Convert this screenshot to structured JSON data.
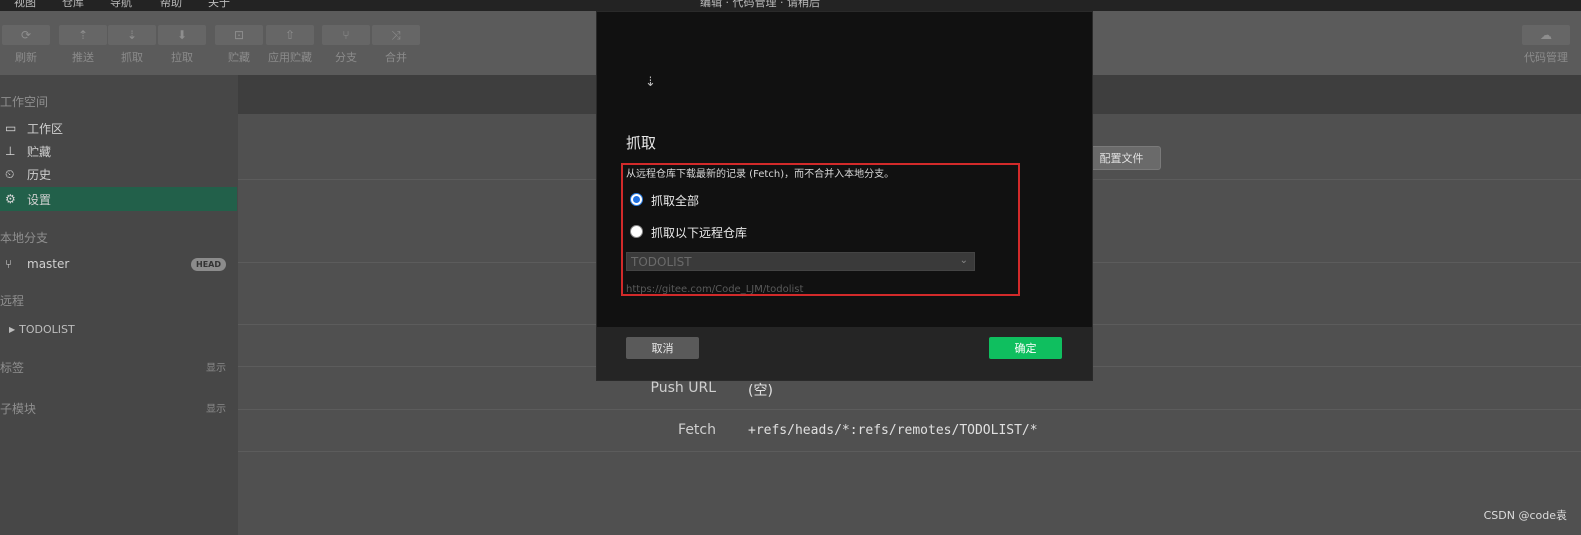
{
  "menu": [
    "视图",
    "仓库",
    "导航",
    "帮助",
    "关于"
  ],
  "title": "编辑 · 代码管理 · 请稍后",
  "toolbar": {
    "buttons": [
      {
        "label": "刷新",
        "icon": "refresh-icon",
        "glyph": "⟳"
      },
      {
        "label": "推送",
        "icon": "push-icon",
        "glyph": "⇡"
      },
      {
        "label": "抓取",
        "icon": "fetch-icon",
        "glyph": "⇣"
      },
      {
        "label": "拉取",
        "icon": "pull-icon",
        "glyph": "⬇"
      },
      {
        "label": "贮藏",
        "icon": "stash-icon",
        "glyph": "⊡"
      },
      {
        "label": "应用贮藏",
        "icon": "apply-stash-icon",
        "glyph": "⇧"
      },
      {
        "label": "分支",
        "icon": "branch-icon",
        "glyph": "⑂"
      },
      {
        "label": "合并",
        "icon": "merge-icon",
        "glyph": "⤨"
      }
    ],
    "right_button": {
      "label": "代码管理",
      "icon": "cloud-icon",
      "glyph": "☁"
    }
  },
  "sidebar": {
    "workspace_header": "工作空间",
    "items": [
      {
        "label": "工作区",
        "icon": "folder-icon",
        "glyph": "▭"
      },
      {
        "label": "贮藏",
        "icon": "stash-icon",
        "glyph": "⊥"
      },
      {
        "label": "历史",
        "icon": "history-icon",
        "glyph": "⏲"
      },
      {
        "label": "设置",
        "icon": "gear-icon",
        "glyph": "⚙"
      }
    ],
    "local_branches_header": "本地分支",
    "branch": {
      "name": "master",
      "badge": "HEAD"
    },
    "remote_header": "远程",
    "remote": {
      "name": "TODOLIST"
    },
    "tags_header": "标签",
    "tags_show": "显示",
    "submodules_header": "子模块",
    "submodules_show": "显示"
  },
  "main": {
    "config_button": "配置文件",
    "push_url_label": "Push URL",
    "push_url_value": "(空)",
    "fetch_label": "Fetch",
    "fetch_value": "+refs/heads/*:refs/remotes/TODOLIST/*"
  },
  "dialog": {
    "title": "抓取",
    "description": "从远程仓库下载最新的记录 (Fetch)，而不合并入本地分支。",
    "option_all": "抓取全部",
    "option_remote": "抓取以下远程仓库",
    "selected_option": "all",
    "remote_select_value": "TODOLIST",
    "remote_url": "https://gitee.com/Code_LJM/todolist",
    "cancel_label": "取消",
    "ok_label": "确定"
  },
  "watermark": "CSDN @code袁",
  "colors": {
    "accent_green": "#0fbf5f",
    "active_item": "#22604a",
    "highlight_red": "#d22a2a",
    "radio_blue": "#1f6fdf"
  }
}
